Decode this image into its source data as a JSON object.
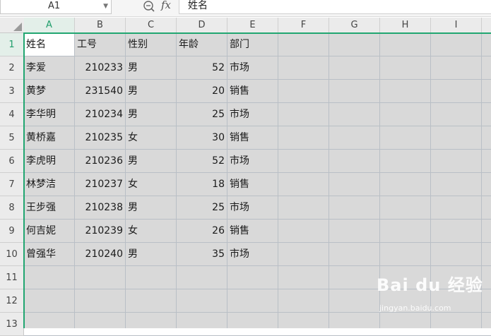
{
  "formula_bar": {
    "name_box": "A1",
    "fx_label": "fx",
    "value": "姓名"
  },
  "columns": [
    "A",
    "B",
    "C",
    "D",
    "E",
    "F",
    "G",
    "H",
    "I"
  ],
  "rows": [
    "1",
    "2",
    "3",
    "4",
    "5",
    "6",
    "7",
    "8",
    "9",
    "10",
    "11",
    "12",
    "13"
  ],
  "selected_cell": "A1",
  "sheet": {
    "header": [
      "姓名",
      "工号",
      "性别",
      "年龄",
      "部门"
    ],
    "records": [
      [
        "李爱",
        "210233",
        "男",
        "52",
        "市场"
      ],
      [
        "黄梦",
        "231540",
        "男",
        "20",
        "销售"
      ],
      [
        "李华明",
        "210234",
        "男",
        "25",
        "市场"
      ],
      [
        "黄桥嘉",
        "210235",
        "女",
        "30",
        "销售"
      ],
      [
        "李虎明",
        "210236",
        "男",
        "52",
        "市场"
      ],
      [
        "林梦洁",
        "210237",
        "女",
        "18",
        "销售"
      ],
      [
        "王步强",
        "210238",
        "男",
        "25",
        "市场"
      ],
      [
        "何吉妮",
        "210239",
        "女",
        "26",
        "销售"
      ],
      [
        "曾强华",
        "210240",
        "男",
        "35",
        "市场"
      ]
    ]
  },
  "watermark": {
    "logo": "Bai du 经验",
    "url": "jingyan.baidu.com"
  },
  "colors": {
    "selection": "#21a671",
    "grid_fill": "#d9d9d9",
    "header_bg": "#ebebeb"
  },
  "icons": {
    "zoom": "zoom-icon",
    "fx": "fx-icon",
    "select_all": "select-all-triangle-icon"
  }
}
